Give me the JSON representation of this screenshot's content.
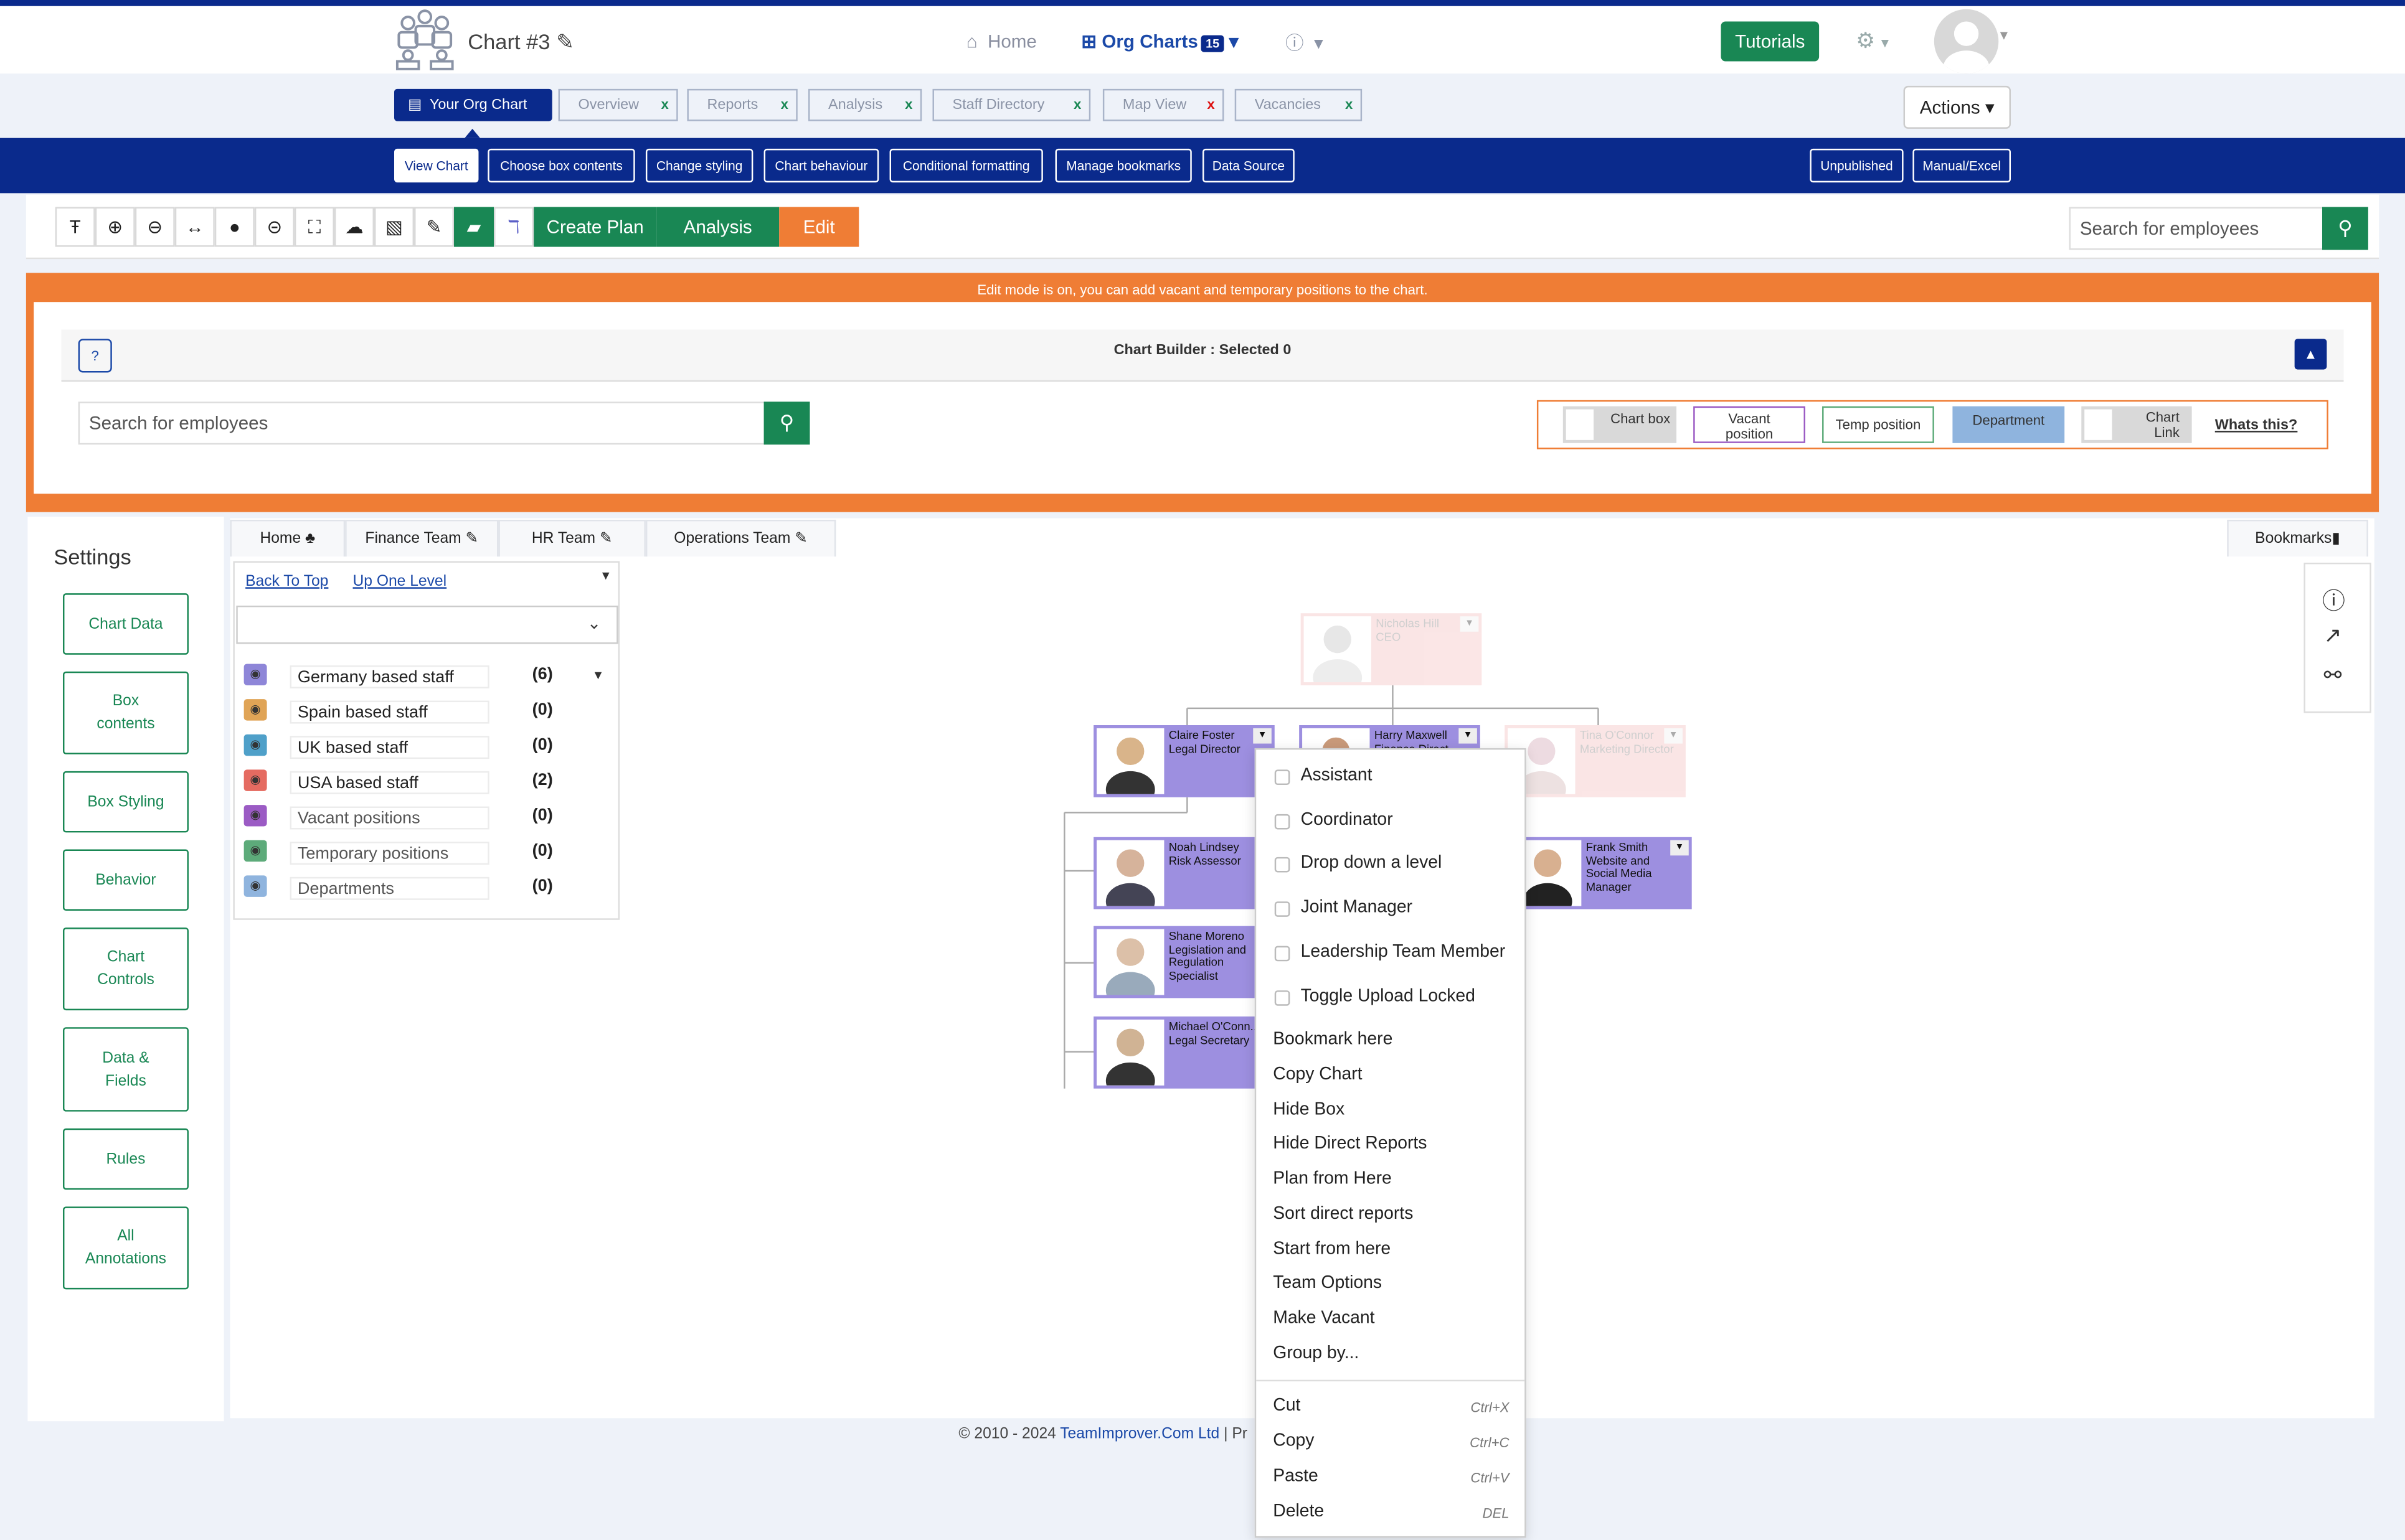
{
  "header": {
    "chart_title": "Chart #3",
    "home": "Home",
    "org_charts": "Org Charts",
    "org_count": "15",
    "tutorials": "Tutorials"
  },
  "tabs": [
    {
      "label": "Your Org Chart"
    },
    {
      "label": "Overview",
      "x": "x"
    },
    {
      "label": "Reports",
      "x": "x"
    },
    {
      "label": "Analysis",
      "x": "x"
    },
    {
      "label": "Staff Directory",
      "x": "x"
    },
    {
      "label": "Map View",
      "x": "x"
    },
    {
      "label": "Vacancies",
      "x": "x"
    }
  ],
  "actions": "Actions",
  "subnav": [
    "View Chart",
    "Choose box contents",
    "Change styling",
    "Chart behaviour",
    "Conditional formatting",
    "Manage bookmarks",
    "Data Source"
  ],
  "subnav_right": [
    "Unpublished",
    "Manual/Excel"
  ],
  "toolbar": {
    "create_plan": "Create Plan",
    "analysis": "Analysis",
    "edit": "Edit",
    "search_placeholder": "Search for employees"
  },
  "edit_message": "Edit mode is on, you can add vacant and temporary positions to the chart.",
  "builder": {
    "title": "Chart Builder : Selected 0",
    "search_placeholder": "Search for employees",
    "legend": {
      "chart_box": "Chart box",
      "vacant1": "Vacant",
      "vacant2": "position",
      "temp": "Temp position",
      "department": "Department",
      "link1": "Chart",
      "link2": "Link",
      "whats_this": "Whats this?"
    }
  },
  "settings": {
    "title": "Settings",
    "buttons": [
      [
        "Chart Data"
      ],
      [
        "Box",
        "contents"
      ],
      [
        "Box Styling"
      ],
      [
        "Behavior"
      ],
      [
        "Chart",
        "Controls"
      ],
      [
        "Data &",
        "Fields"
      ],
      [
        "Rules"
      ],
      [
        "All",
        "Annotations"
      ]
    ]
  },
  "team_tabs": [
    "Home",
    "Finance Team",
    "HR Team",
    "Operations Team"
  ],
  "bookmarks": "Bookmarks",
  "filter": {
    "back_to_top": "Back To Top",
    "up_one_level": "Up One Level",
    "rows": [
      {
        "label": "Germany based staff",
        "count": "(6)",
        "color": "#8e86d8"
      },
      {
        "label": "Spain based staff",
        "count": "(0)",
        "color": "#e0a456"
      },
      {
        "label": "UK based staff",
        "count": "(0)",
        "color": "#4fa0c9"
      },
      {
        "label": "USA based staff",
        "count": "(2)",
        "color": "#e56b61"
      },
      {
        "label": "Vacant positions",
        "count": "(0)",
        "color": "#9b5bc4"
      },
      {
        "label": "Temporary positions",
        "count": "(0)",
        "color": "#5dab7a"
      },
      {
        "label": "Departments",
        "count": "(0)",
        "color": "#8fb4de"
      }
    ]
  },
  "cards": {
    "ceo": [
      "Nicholas Hill",
      "CEO"
    ],
    "claire": [
      "Claire Foster",
      "Legal Director"
    ],
    "harry": [
      "Harry Maxwell",
      "Finance Direct..."
    ],
    "tina": [
      "Tina O'Connor",
      "Marketing Director"
    ],
    "noah": [
      "Noah Lindsey",
      "Risk Assessor"
    ],
    "frank": [
      "Frank Smith",
      "Website and",
      "Social Media",
      "Manager"
    ],
    "shane": [
      "Shane Moreno",
      "Legislation and",
      "Regulation",
      "Specialist"
    ],
    "michael": [
      "Michael O'Conn...",
      "Legal Secretary"
    ]
  },
  "context_menu": {
    "checks": [
      "Assistant",
      "Coordinator",
      "Drop down a level",
      "Joint Manager",
      "Leadership Team Member",
      "Toggle Upload Locked"
    ],
    "items": [
      "Bookmark here",
      "Copy Chart",
      "Hide Box",
      "Hide Direct Reports",
      "Plan from Here",
      "Sort direct reports",
      "Start from here",
      "Team Options",
      "Make Vacant",
      "Group by..."
    ],
    "edit": [
      {
        "label": "Cut",
        "key": "Ctrl+X"
      },
      {
        "label": "Copy",
        "key": "Ctrl+C"
      },
      {
        "label": "Paste",
        "key": "Ctrl+V"
      },
      {
        "label": "Delete",
        "key": "DEL"
      }
    ]
  },
  "footer": {
    "copy": "© 2010 - 2024 ",
    "company": "TeamImprover.Com Ltd",
    "sep": " | Pr"
  }
}
